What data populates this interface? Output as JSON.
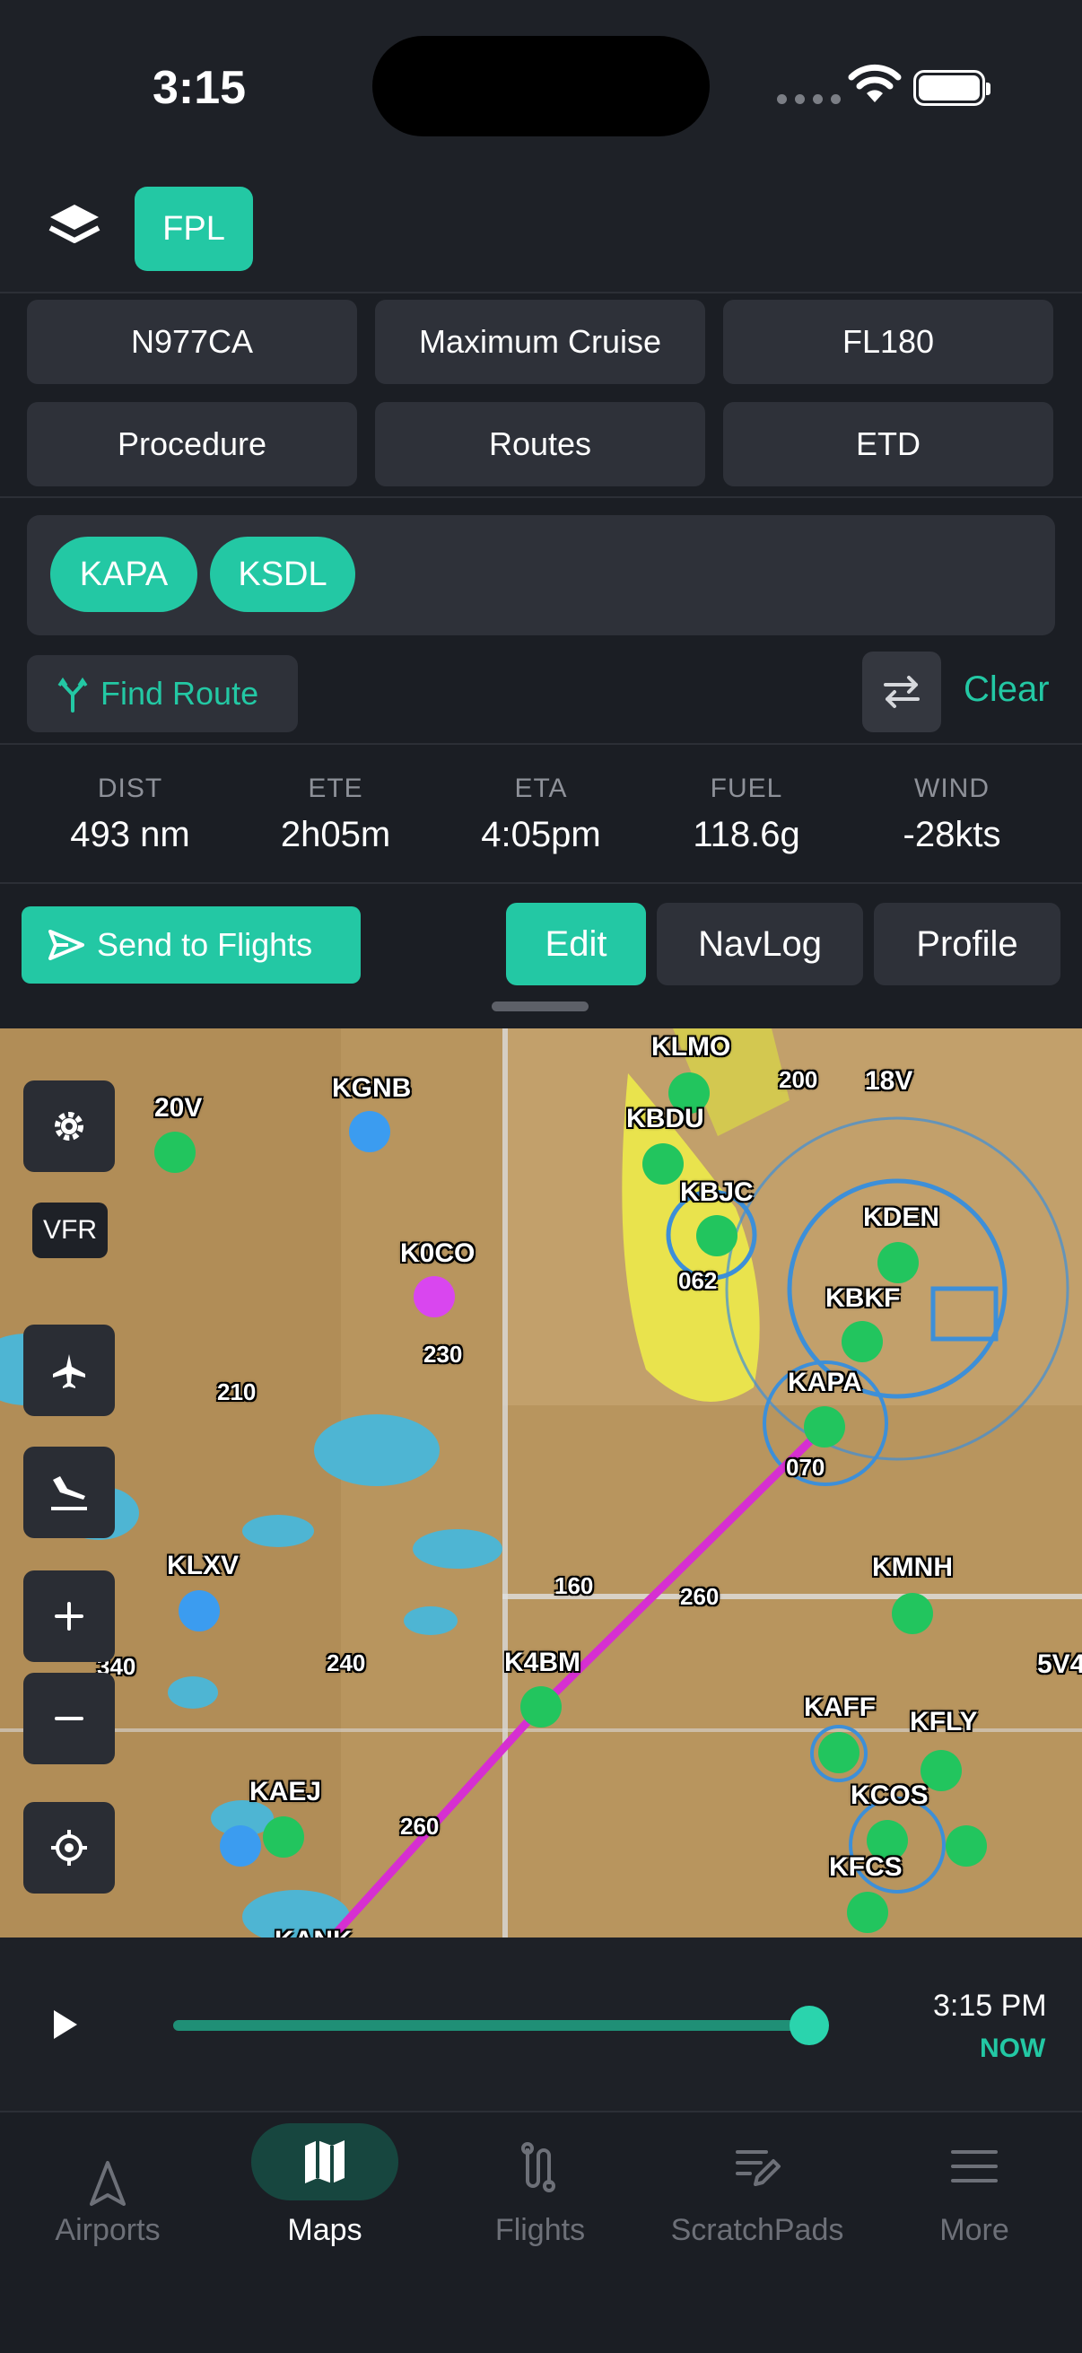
{
  "status_bar": {
    "time": "3:15"
  },
  "header": {
    "fpl_label": "FPL"
  },
  "options": {
    "aircraft": "N977CA",
    "power": "Maximum Cruise",
    "altitude": "FL180",
    "procedure": "Procedure",
    "routes": "Routes",
    "etd": "ETD"
  },
  "route": {
    "waypoints": [
      "KAPA",
      "KSDL"
    ],
    "find_route": "Find Route",
    "clear": "Clear"
  },
  "stats": [
    {
      "label": "DIST",
      "value": "493 nm"
    },
    {
      "label": "ETE",
      "value": "2h05m"
    },
    {
      "label": "ETA",
      "value": "4:05pm"
    },
    {
      "label": "FUEL",
      "value": "118.6g"
    },
    {
      "label": "WIND",
      "value": "-28kts"
    }
  ],
  "actions": {
    "send": "Send to Flights",
    "tabs": [
      "Edit",
      "NavLog",
      "Profile"
    ],
    "active_tab": "Edit"
  },
  "map": {
    "vfr_label": "VFR",
    "airports": [
      "KLMO",
      "20V",
      "KGNB",
      "KBDU",
      "18V",
      "KBJC",
      "KDEN",
      "K0CO",
      "KBKF",
      "KAPA",
      "KLXV",
      "KMNH",
      "K4BM",
      "5V4",
      "KAFF",
      "KFLY",
      "KAEJ",
      "KCOS",
      "KFCS",
      "KANK"
    ],
    "numbers": [
      "200",
      "062",
      "210",
      "230",
      "070",
      "160",
      "260",
      "340",
      "240",
      "260"
    ]
  },
  "timeline": {
    "time": "3:15 PM",
    "label": "NOW"
  },
  "tabbar": {
    "items": [
      "Airports",
      "Maps",
      "Flights",
      "ScratchPads",
      "More"
    ],
    "active": "Maps"
  },
  "colors": {
    "accent": "#23c8a4",
    "route": "#d62fd1",
    "background": "#1b1e24"
  }
}
